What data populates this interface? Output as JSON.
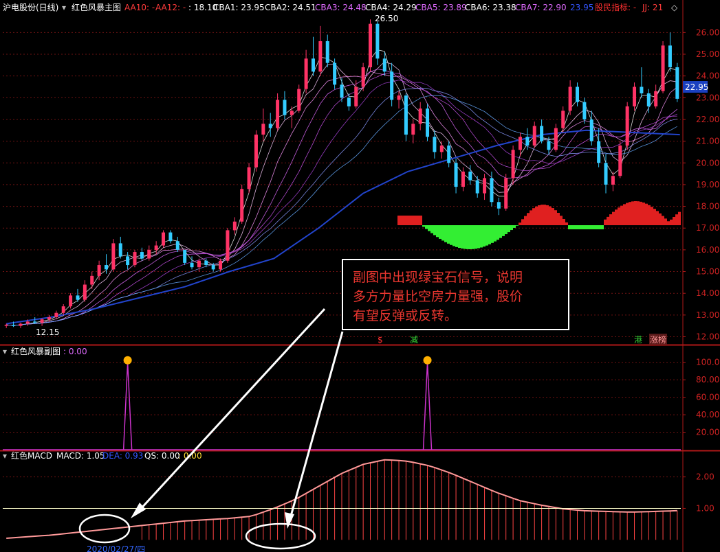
{
  "header": {
    "stock_title": "沪电股份(日线)",
    "main_indicator_name": "红色风暴主图",
    "aa10": "AA10: -",
    "aa12": "AA12: -",
    "val_18_10": ": 18.10",
    "cba1": "CBA1: 23.95",
    "cba2": "CBA2: 24.51",
    "cba3": "CBA3: 24.48",
    "cba4": "CBA4: 24.29",
    "cba5": "CBA5: 23.89",
    "cba6": "CBA6: 23.38",
    "cba7": "CBA7: 22.90",
    "val_23_95": "23.95",
    "gumin": "股民指标: -",
    "jj": "JJ: 21",
    "diamond": "◇",
    "colors": {
      "aa": "#ff3b3b",
      "cba": "#e06bff",
      "white": "#ffffff",
      "blue": "#3355ff",
      "red": "#ff3030"
    }
  },
  "sub1": {
    "name": "红色风暴副图",
    "value": ": 0.00"
  },
  "sub2": {
    "name": "红色MACD",
    "macd": "MACD: 1.05",
    "dea": "DEA: 0.93",
    "qs": "QS: 0.00",
    "extra": ": 0.00"
  },
  "annotation": {
    "lines": [
      "副图中出现绿宝石信号，说明",
      "多方力量比空房力量强，股价",
      "有望反弹或反转。"
    ]
  },
  "chart_labels": {
    "peak": "26.50",
    "low": "12.15",
    "last_price": "22.95",
    "bottom_date": "2020/02/27/四"
  },
  "event_markers": [
    {
      "label": "$",
      "color": "#ff3030"
    },
    {
      "label": "减",
      "color": "#33cc33"
    },
    {
      "label": "港",
      "color": "#33cc33"
    },
    {
      "label": "涨榜",
      "color": "#ff9999"
    }
  ],
  "chart_data": [
    {
      "type": "candlestick",
      "title": "红色风暴主图",
      "yticks": [
        26.0,
        25.0,
        24.0,
        23.0,
        22.0,
        21.0,
        20.0,
        19.0,
        18.0,
        17.0,
        16.0,
        15.0,
        14.0,
        13.0,
        12.0
      ],
      "ylim": [
        11.7,
        26.8
      ],
      "candles": [
        [
          12.5,
          12.6,
          12.4,
          12.55
        ],
        [
          12.55,
          12.7,
          12.45,
          12.5
        ],
        [
          12.5,
          12.65,
          12.4,
          12.6
        ],
        [
          12.6,
          12.8,
          12.5,
          12.7
        ],
        [
          12.7,
          12.9,
          12.6,
          12.65
        ],
        [
          12.65,
          12.85,
          12.5,
          12.8
        ],
        [
          12.8,
          13.0,
          12.7,
          12.9
        ],
        [
          12.9,
          13.2,
          12.8,
          13.1
        ],
        [
          13.1,
          13.5,
          13.0,
          13.4
        ],
        [
          13.4,
          14.0,
          13.3,
          13.9
        ],
        [
          13.9,
          14.2,
          13.6,
          13.7
        ],
        [
          13.7,
          14.6,
          13.6,
          14.4
        ],
        [
          14.4,
          15.0,
          14.2,
          14.8
        ],
        [
          14.8,
          15.5,
          14.6,
          15.3
        ],
        [
          15.3,
          15.8,
          14.9,
          15.1
        ],
        [
          15.1,
          16.5,
          15.0,
          16.3
        ],
        [
          16.3,
          16.6,
          15.6,
          15.7
        ],
        [
          15.7,
          15.9,
          15.1,
          15.3
        ],
        [
          15.3,
          16.0,
          15.2,
          15.9
        ],
        [
          15.9,
          16.1,
          15.5,
          15.6
        ],
        [
          15.6,
          16.2,
          15.5,
          16.0
        ],
        [
          16.0,
          16.4,
          15.8,
          16.2
        ],
        [
          16.2,
          16.9,
          16.1,
          16.8
        ],
        [
          16.8,
          16.9,
          16.3,
          16.4
        ],
        [
          16.4,
          16.6,
          15.9,
          16.0
        ],
        [
          16.0,
          15.9,
          15.3,
          15.4
        ],
        [
          15.4,
          15.7,
          15.1,
          15.2
        ],
        [
          15.2,
          15.6,
          15.0,
          15.5
        ],
        [
          15.5,
          15.6,
          15.2,
          15.3
        ],
        [
          15.3,
          15.4,
          15.0,
          15.1
        ],
        [
          15.1,
          15.6,
          15.0,
          15.5
        ],
        [
          15.5,
          17.0,
          15.4,
          16.9
        ],
        [
          16.9,
          17.5,
          16.7,
          17.3
        ],
        [
          17.3,
          19.0,
          17.2,
          18.8
        ],
        [
          18.8,
          20.0,
          18.6,
          19.8
        ],
        [
          19.8,
          21.5,
          19.6,
          21.3
        ],
        [
          21.3,
          22.5,
          21.0,
          21.8
        ],
        [
          21.8,
          22.3,
          21.2,
          21.6
        ],
        [
          21.6,
          23.2,
          21.5,
          22.9
        ],
        [
          22.9,
          23.3,
          22.0,
          22.2
        ],
        [
          22.2,
          22.6,
          21.6,
          22.4
        ],
        [
          22.4,
          23.6,
          22.3,
          23.4
        ],
        [
          23.4,
          25.2,
          23.2,
          24.8
        ],
        [
          24.8,
          25.8,
          24.0,
          24.2
        ],
        [
          24.2,
          26.3,
          24.0,
          25.6
        ],
        [
          25.6,
          25.9,
          24.4,
          24.6
        ],
        [
          24.6,
          24.8,
          23.4,
          23.6
        ],
        [
          23.6,
          23.9,
          22.8,
          23.0
        ],
        [
          23.0,
          23.2,
          22.4,
          22.6
        ],
        [
          22.6,
          23.8,
          22.5,
          23.5
        ],
        [
          23.5,
          24.6,
          23.3,
          24.4
        ],
        [
          24.4,
          26.6,
          24.2,
          26.4
        ],
        [
          26.4,
          26.5,
          24.5,
          24.8
        ],
        [
          24.8,
          25.1,
          24.0,
          24.2
        ],
        [
          24.2,
          24.6,
          22.6,
          22.9
        ],
        [
          22.9,
          23.3,
          22.5,
          23.1
        ],
        [
          23.1,
          23.2,
          21.0,
          21.3
        ],
        [
          21.3,
          22.0,
          20.9,
          21.8
        ],
        [
          21.8,
          22.8,
          21.5,
          22.5
        ],
        [
          22.5,
          22.7,
          21.0,
          21.2
        ],
        [
          21.2,
          21.5,
          20.2,
          20.5
        ],
        [
          20.5,
          21.0,
          20.2,
          20.8
        ],
        [
          20.8,
          21.0,
          19.8,
          20.0
        ],
        [
          20.0,
          20.2,
          18.6,
          18.9
        ],
        [
          18.9,
          19.8,
          18.7,
          19.6
        ],
        [
          19.6,
          19.9,
          19.0,
          19.2
        ],
        [
          19.2,
          19.4,
          18.4,
          18.6
        ],
        [
          18.6,
          19.5,
          18.3,
          19.3
        ],
        [
          19.3,
          19.6,
          18.0,
          18.2
        ],
        [
          18.2,
          18.4,
          17.6,
          17.9
        ],
        [
          17.9,
          19.5,
          17.8,
          19.3
        ],
        [
          19.3,
          20.8,
          19.0,
          20.6
        ],
        [
          20.6,
          21.4,
          20.3,
          21.2
        ],
        [
          21.2,
          21.6,
          20.6,
          20.8
        ],
        [
          20.8,
          21.9,
          20.7,
          21.7
        ],
        [
          21.7,
          22.0,
          20.9,
          21.0
        ],
        [
          21.0,
          21.2,
          20.4,
          20.6
        ],
        [
          20.6,
          21.8,
          20.5,
          21.6
        ],
        [
          21.6,
          22.6,
          21.4,
          22.4
        ],
        [
          22.4,
          23.8,
          22.2,
          23.5
        ],
        [
          23.5,
          23.7,
          22.6,
          22.8
        ],
        [
          22.8,
          23.0,
          21.8,
          22.0
        ],
        [
          22.0,
          22.4,
          20.8,
          21.0
        ],
        [
          21.0,
          21.6,
          19.8,
          20.0
        ],
        [
          20.0,
          20.4,
          18.6,
          19.0
        ],
        [
          19.0,
          19.6,
          18.7,
          19.4
        ],
        [
          19.4,
          21.0,
          19.3,
          20.8
        ],
        [
          20.8,
          22.8,
          20.6,
          22.6
        ],
        [
          22.6,
          23.7,
          22.4,
          23.5
        ],
        [
          23.5,
          24.4,
          23.0,
          23.2
        ],
        [
          23.2,
          23.4,
          22.3,
          22.6
        ],
        [
          22.6,
          23.6,
          22.5,
          23.3
        ],
        [
          23.3,
          25.6,
          23.2,
          25.4
        ],
        [
          25.4,
          26.0,
          24.2,
          24.4
        ],
        [
          24.4,
          24.6,
          22.8,
          22.95
        ]
      ],
      "ma_long": [
        [
          0,
          12.6
        ],
        [
          10,
          12.9
        ],
        [
          20,
          13.3
        ],
        [
          30,
          13.8
        ],
        [
          40,
          14.3
        ],
        [
          50,
          15.0
        ],
        [
          60,
          15.6
        ],
        [
          70,
          17.0
        ],
        [
          80,
          18.6
        ],
        [
          90,
          19.6
        ],
        [
          100,
          20.2
        ],
        [
          110,
          20.8
        ],
        [
          120,
          21.3
        ],
        [
          130,
          21.5
        ],
        [
          140,
          21.4
        ],
        [
          151,
          21.3
        ]
      ]
    },
    {
      "type": "line",
      "title": "红色风暴副图",
      "yticks": [
        100.0,
        80.0,
        60.0,
        40.0,
        20.0
      ],
      "ylim": [
        0,
        110
      ],
      "spikes": [
        {
          "bar": 17,
          "value": 100
        },
        {
          "bar": 59,
          "value": 100
        }
      ]
    },
    {
      "type": "bar",
      "title": "红色MACD",
      "yticks": [
        2.0,
        1.0
      ],
      "ylim": [
        -0.3,
        2.8
      ],
      "macd": [
        [
          0,
          0.05
        ],
        [
          10,
          0.15
        ],
        [
          20,
          0.3
        ],
        [
          30,
          0.45
        ],
        [
          40,
          0.6
        ],
        [
          50,
          0.68
        ],
        [
          55,
          0.75
        ],
        [
          60,
          1.0
        ],
        [
          65,
          1.3
        ],
        [
          70,
          1.7
        ],
        [
          75,
          2.1
        ],
        [
          80,
          2.4
        ],
        [
          85,
          2.55
        ],
        [
          90,
          2.5
        ],
        [
          95,
          2.35
        ],
        [
          100,
          2.1
        ],
        [
          105,
          1.8
        ],
        [
          110,
          1.5
        ],
        [
          115,
          1.25
        ],
        [
          120,
          1.1
        ],
        [
          125,
          0.98
        ],
        [
          130,
          0.92
        ],
        [
          135,
          0.9
        ],
        [
          140,
          0.88
        ],
        [
          145,
          0.9
        ],
        [
          151,
          0.93
        ]
      ]
    }
  ]
}
